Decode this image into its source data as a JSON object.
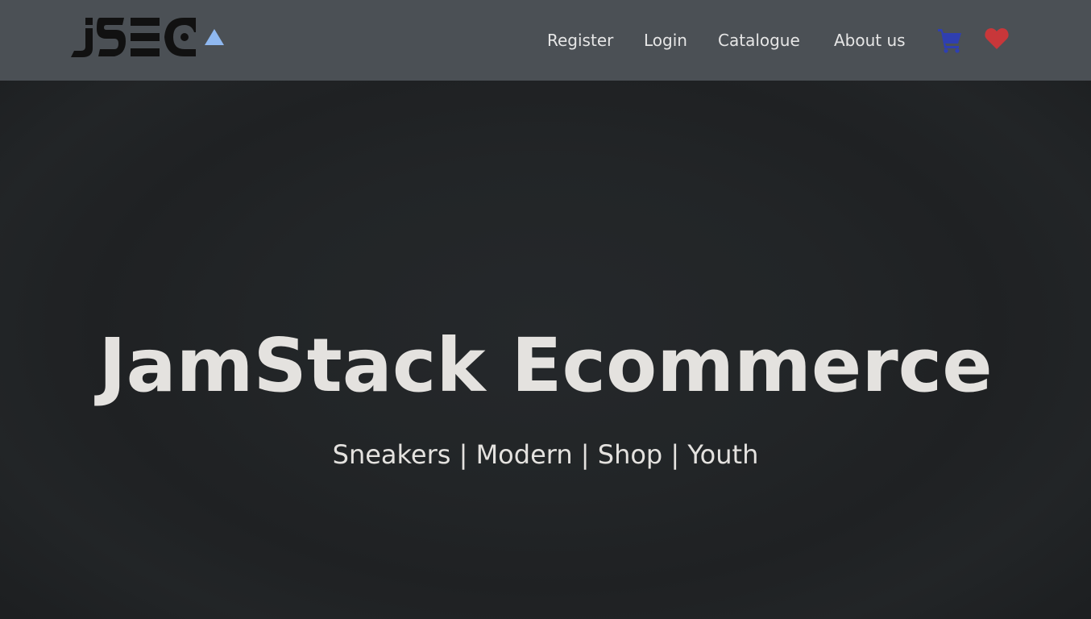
{
  "brand": {
    "logo_text": "JSEC",
    "accent_color": "#8fb8f0"
  },
  "nav": {
    "items": [
      {
        "label": "Register"
      },
      {
        "label": "Login"
      },
      {
        "label": "Catalogue"
      },
      {
        "label": "About us"
      }
    ],
    "cart_icon": "shopping-cart-icon",
    "cart_color": "#2f3fb0",
    "wishlist_icon": "heart-icon",
    "wishlist_color": "#c8373a"
  },
  "hero": {
    "title": "JamStack Ecommerce",
    "subtitle": "Sneakers | Modern | Shop | Youth"
  },
  "colors": {
    "navbar_bg": "#4b5055",
    "hero_bg": "#1e2022",
    "text": "#e4e2df"
  }
}
